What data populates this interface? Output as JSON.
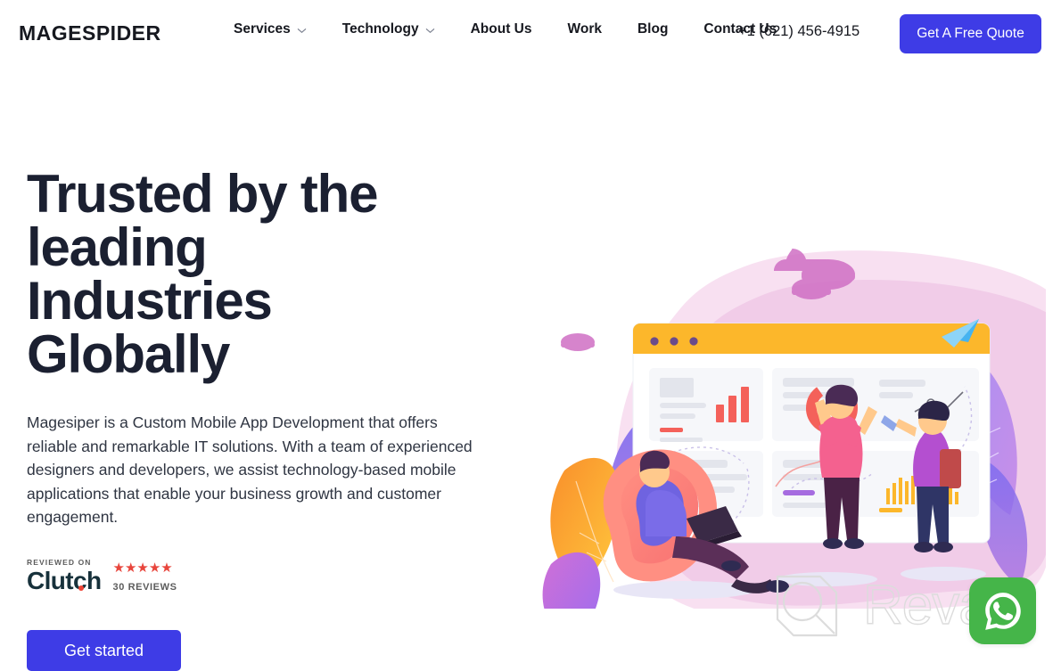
{
  "header": {
    "logo": "MAGESPIDER",
    "nav": [
      {
        "label": "Services",
        "has_dropdown": true
      },
      {
        "label": "Technology",
        "has_dropdown": true
      },
      {
        "label": "About Us",
        "has_dropdown": false
      },
      {
        "label": "Work",
        "has_dropdown": false
      },
      {
        "label": "Blog",
        "has_dropdown": false
      },
      {
        "label": "Contact Us",
        "has_dropdown": false
      }
    ],
    "phone": "+1 (621) 456-4915",
    "cta_label": "Get A Free Quote",
    "cta_color": "#3e3ce6"
  },
  "hero": {
    "title": "Trusted by the leading Industries Globally",
    "subtitle": "Magesiper is a Custom Mobile App Development that offers reliable and remarkable IT solutions. With a team of experienced designers and developers, we assist technology-based mobile applications that enable your business growth and customer engagement.",
    "cta_label": "Get started",
    "cta_color": "#3e3ce6"
  },
  "review_badge": {
    "reviewed_on": "REVIEWED ON",
    "platform": "Clutch",
    "stars": "★★★★★",
    "rating": 5,
    "reviews_count": "30 REVIEWS",
    "star_color": "#e8453c"
  },
  "watermark": {
    "text": "Revain",
    "color": "#dcdcdc"
  },
  "chat_widget": {
    "label": "WhatsApp",
    "color": "#45b549"
  },
  "illustration": {
    "alt": "Team analysing dashboard charts on a large browser window",
    "browser_bar_color": "#fcb72b",
    "blob_color": "#f0c2e0"
  }
}
